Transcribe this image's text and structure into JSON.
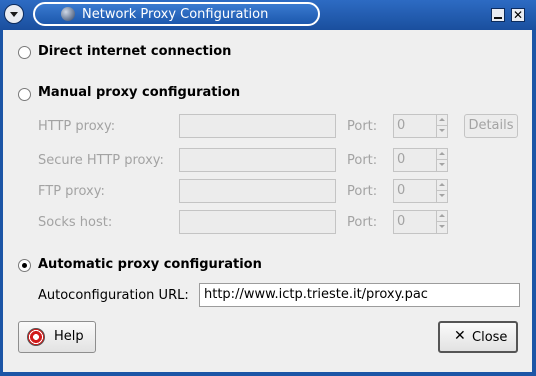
{
  "window": {
    "title": "Network Proxy Configuration"
  },
  "options": {
    "direct": {
      "label": "Direct internet connection",
      "checked": false
    },
    "manual": {
      "label": "Manual proxy configuration",
      "checked": false
    },
    "automatic": {
      "label": "Automatic proxy configuration",
      "checked": true
    }
  },
  "manual_proxy": {
    "port_label": "Port:",
    "details_label": "Details",
    "rows": [
      {
        "label": "HTTP proxy:",
        "value": "",
        "port": "0"
      },
      {
        "label": "Secure HTTP proxy:",
        "value": "",
        "port": "0"
      },
      {
        "label": "FTP proxy:",
        "value": "",
        "port": "0"
      },
      {
        "label": "Socks host:",
        "value": "",
        "port": "0"
      }
    ]
  },
  "autoconfig": {
    "label": "Autoconfiguration URL:",
    "url": "http://www.ictp.trieste.it/proxy.pac"
  },
  "buttons": {
    "help": "Help",
    "close": "Close"
  },
  "icons": {
    "window_menu": "chevron-down-icon",
    "title": "globe-icon",
    "minimize": "minimize-icon",
    "close": "close-icon",
    "help": "lifebuoy-icon",
    "close_button": "x-icon"
  },
  "colors": {
    "titlebar": "#1c55a6",
    "dialog_bg": "#efefef",
    "disabled_text": "#a3a3a3"
  }
}
